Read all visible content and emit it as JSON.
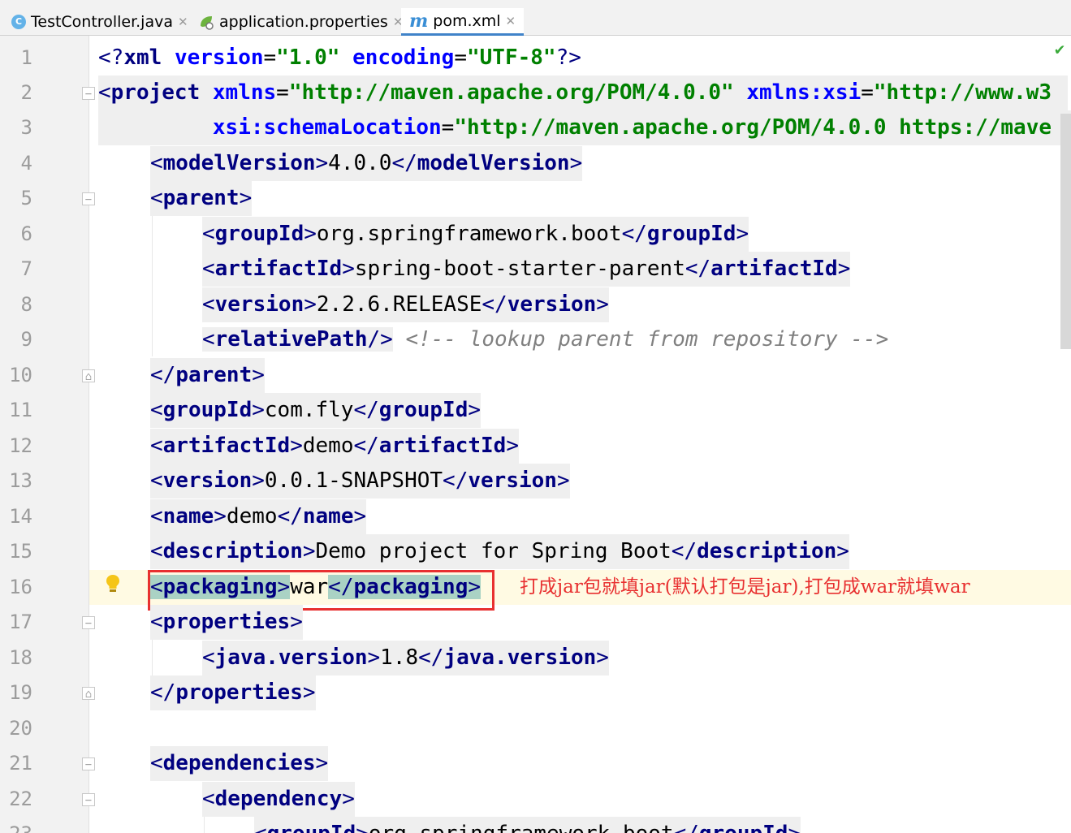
{
  "tabs": [
    {
      "label": "TestController.java",
      "icon": "class-c-icon",
      "active": false
    },
    {
      "label": "application.properties",
      "icon": "spring-leaf-icon",
      "active": false
    },
    {
      "label": "pom.xml",
      "icon": "maven-m-icon",
      "active": true
    }
  ],
  "editor": {
    "line_numbers": [
      "1",
      "2",
      "3",
      "4",
      "5",
      "6",
      "7",
      "8",
      "9",
      "10",
      "11",
      "12",
      "13",
      "14",
      "15",
      "16",
      "17",
      "18",
      "19",
      "20",
      "21",
      "22",
      "23"
    ],
    "annotation_note": "打成jar包就填jar(默认打包是jar),打包成war就填war",
    "code": {
      "l1_decl": "<?",
      "l1_xml": "xml",
      "l1_version_attr": "version",
      "l1_version_val": "\"1.0\"",
      "l1_encoding_attr": "encoding",
      "l1_encoding_val": "\"UTF-8\"",
      "l1_end": "?>",
      "l2_tag": "project",
      "l2_xmlns": "xmlns",
      "l2_xmlns_val": "\"http://maven.apache.org/POM/4.0.0\"",
      "l2_xsi": "xmlns:xsi",
      "l2_xsi_val": "\"http://www.w3",
      "l3_attr": "xsi:schemaLocation",
      "l3_val": "\"http://maven.apache.org/POM/4.0.0 https://mave",
      "modelVersion": "modelVersion",
      "modelVersion_val": "4.0.0",
      "parent": "parent",
      "groupId": "groupId",
      "parent_groupId_val": "org.springframework.boot",
      "artifactId": "artifactId",
      "parent_artifactId_val": "spring-boot-starter-parent",
      "version": "version",
      "parent_version_val": "2.2.6.RELEASE",
      "relativePath": "relativePath",
      "comment": "<!-- lookup parent from repository -->",
      "groupId_val": "com.fly",
      "artifactId_val": "demo",
      "version_val": "0.0.1-SNAPSHOT",
      "name": "name",
      "name_val": "demo",
      "description": "description",
      "description_val": "Demo project for Spring Boot",
      "packaging": "packaging",
      "packaging_val": "war",
      "properties": "properties",
      "java_version": "java.version",
      "java_version_val": "1.8",
      "dependencies": "dependencies",
      "dependency": "dependency",
      "l23_groupId_val": "org.springframework.boot"
    }
  }
}
